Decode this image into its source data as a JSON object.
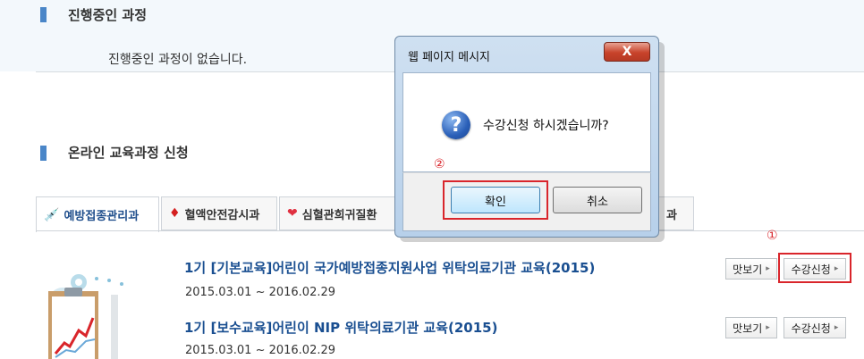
{
  "in_progress": {
    "title": "진행중인 과정",
    "empty_message": "진행중인 과정이 없습니다."
  },
  "online": {
    "title": "온라인 교육과정 신청"
  },
  "tabs": [
    {
      "label": "예방접종관리과",
      "icon": "syringe-icon",
      "glyph": "💉"
    },
    {
      "label": "혈액안전감시과",
      "icon": "blood-drop-icon",
      "glyph": "♦"
    },
    {
      "label": "심혈관희귀질환",
      "icon": "heart-icon",
      "glyph": "❤"
    },
    {
      "label": "과"
    }
  ],
  "courses": [
    {
      "title": "1기 [기본교육]어린이 국가예방접종지원사업 위탁의료기관 교육(2015)",
      "date": "2015.03.01 ~ 2016.02.29",
      "preview_label": "맛보기",
      "enroll_label": "수강신청"
    },
    {
      "title": "1기 [보수교육]어린이 NIP 위탁의료기관 교육(2015)",
      "date": "2015.03.01 ~ 2016.02.29",
      "preview_label": "맛보기",
      "enroll_label": "수강신청"
    }
  ],
  "annotations": {
    "step1": "①",
    "step2": "②",
    "highlight_color": "#d9252b"
  },
  "dialog": {
    "title": "웹 페이지 메시지",
    "close_glyph": "X",
    "icon": "question-icon",
    "icon_glyph": "?",
    "message": "수강신청 하시겠습니까?",
    "ok_label": "확인",
    "cancel_label": "취소"
  },
  "colors": {
    "accent_blue": "#1a4f91",
    "section_marker": "#4a86c8"
  }
}
